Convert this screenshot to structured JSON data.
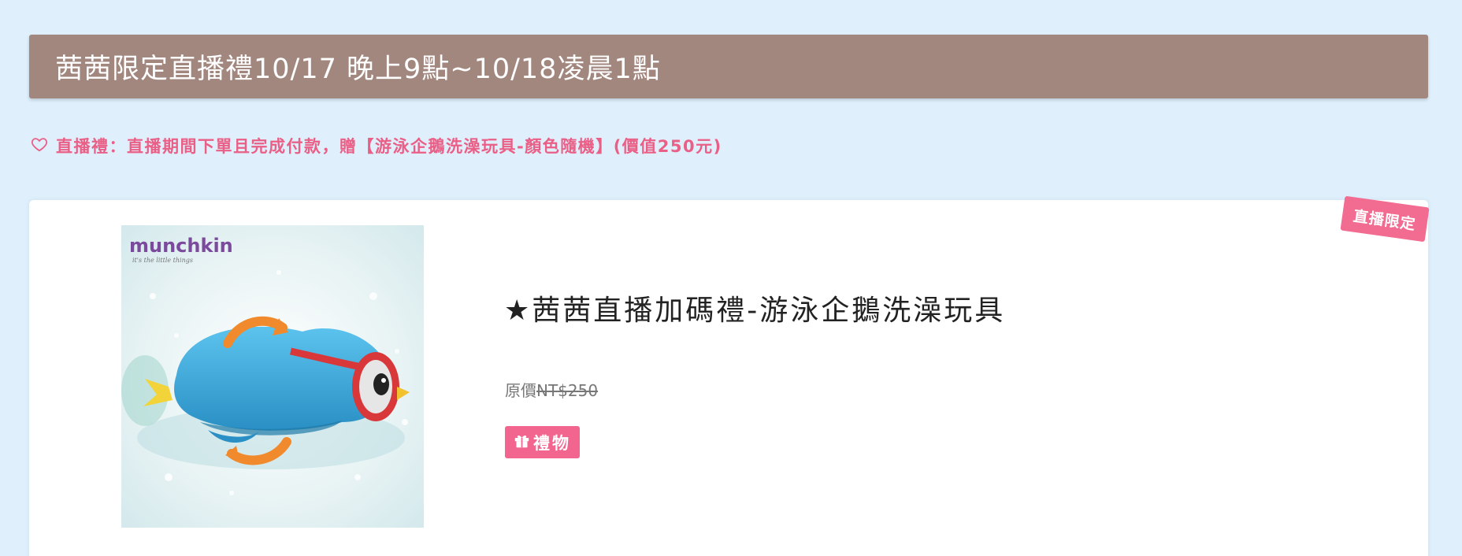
{
  "banner": {
    "title": "茜茜限定直播禮10/17 晚上9點~10/18凌晨1點"
  },
  "notice": {
    "icon": "heart-outline-icon",
    "text": "直播禮：直播期間下單且完成付款，贈【游泳企鵝洗澡玩具-顏色隨機】(價值250元)"
  },
  "product": {
    "ribbon": "直播限定",
    "image_alt": "munchkin penguin bath toy",
    "brand_logo": "munchkin",
    "brand_tagline": "it's the little things",
    "title": "★茜茜直播加碼禮-游泳企鵝洗澡玩具",
    "price_label": "原價",
    "price_value": "NT$250",
    "tag_icon": "gift-icon",
    "tag_label": "禮物"
  },
  "colors": {
    "background": "#dff0fc",
    "banner": "#a2877f",
    "accent_pink": "#ea5f86",
    "tag_pink": "#f2658e"
  }
}
